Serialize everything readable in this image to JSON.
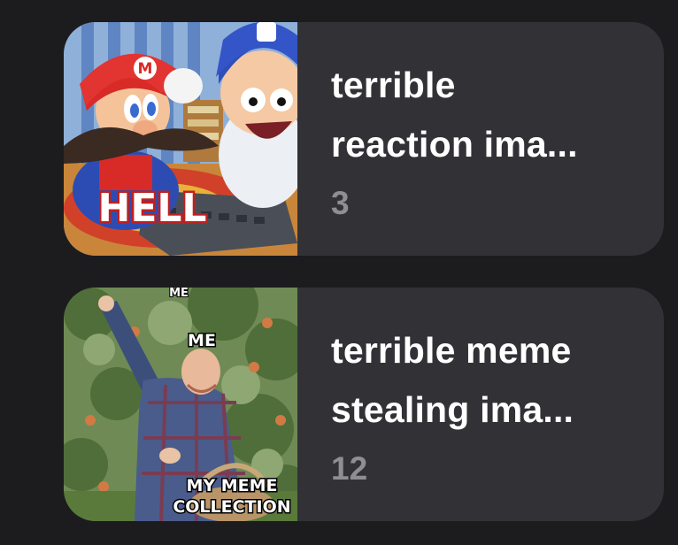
{
  "collections": [
    {
      "title_line1": "terrible",
      "title_line2": "reaction ima...",
      "count": "3",
      "thumbnail": {
        "icon": "mario-hell-reaction-image",
        "caption": "HELL"
      }
    },
    {
      "title_line1": "terrible meme",
      "title_line2": "stealing ima...",
      "count": "12",
      "thumbnail": {
        "icon": "man-picking-apples-meme-image",
        "caption_top": "ME",
        "caption_bottom_line1": "MY MEME",
        "caption_bottom_line2": "COLLECTION"
      }
    }
  ]
}
